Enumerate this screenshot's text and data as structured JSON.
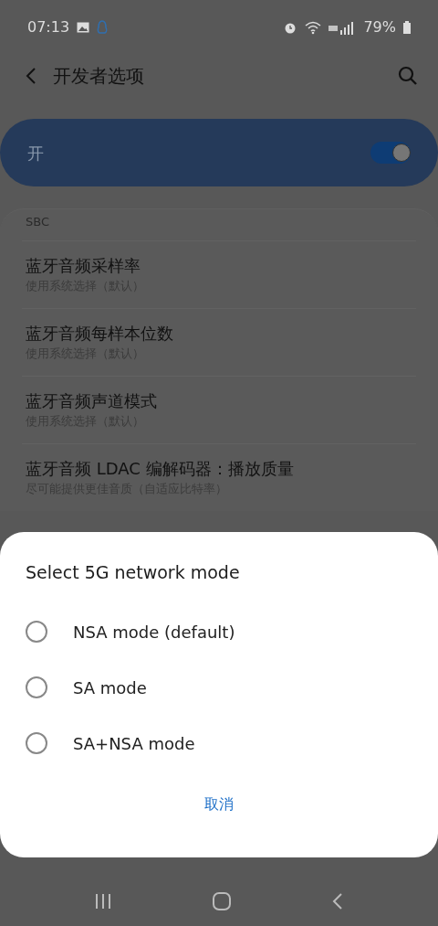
{
  "status_bar": {
    "time": "07:13",
    "battery": "79%"
  },
  "header": {
    "title": "开发者选项"
  },
  "master_switch": {
    "label": "开",
    "on": true
  },
  "section": {
    "title": "SBC"
  },
  "settings": [
    {
      "title": "蓝牙音频采样率",
      "summary": "使用系统选择（默认）"
    },
    {
      "title": "蓝牙音频每样本位数",
      "summary": "使用系统选择（默认）"
    },
    {
      "title": "蓝牙音频声道模式",
      "summary": "使用系统选择（默认）"
    },
    {
      "title": "蓝牙音频 LDAC 编解码器：播放质量",
      "summary": "尽可能提供更佳音质（自适应比特率）"
    }
  ],
  "dialog": {
    "title": "Select 5G network mode",
    "options": [
      {
        "label": "NSA mode (default)",
        "selected": false
      },
      {
        "label": "SA mode",
        "selected": false
      },
      {
        "label": "SA+NSA mode",
        "selected": false
      }
    ],
    "cancel": "取消"
  }
}
